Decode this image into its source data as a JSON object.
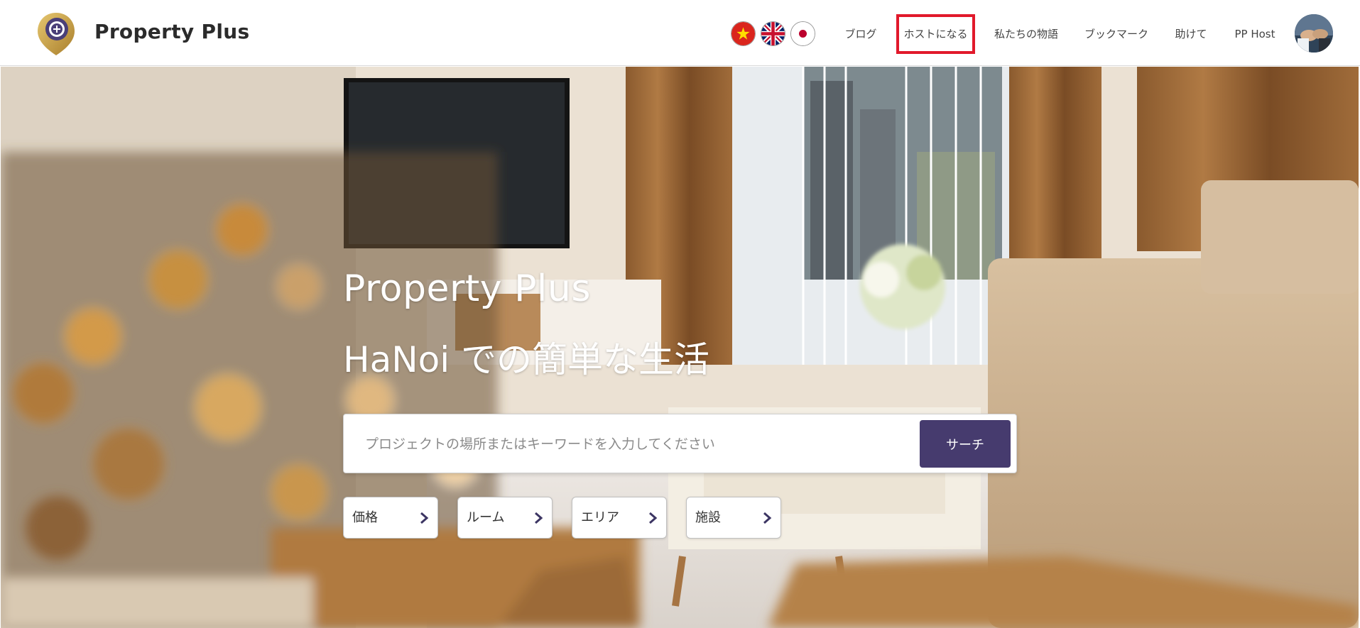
{
  "header": {
    "brand": "Property Plus",
    "flags": [
      {
        "name": "vietnam-flag-icon",
        "label": "Vietnamese"
      },
      {
        "name": "uk-flag-icon",
        "label": "English"
      },
      {
        "name": "japan-flag-icon",
        "label": "Japanese"
      }
    ],
    "nav": [
      {
        "id": "blog",
        "label": "ブログ"
      },
      {
        "id": "become-host",
        "label": "ホストになる",
        "highlighted": true
      },
      {
        "id": "our-story",
        "label": "私たちの物語"
      },
      {
        "id": "bookmark",
        "label": "ブックマーク"
      },
      {
        "id": "help",
        "label": "助けて"
      },
      {
        "id": "pp-host",
        "label": "PP Host"
      }
    ],
    "avatar_icon": "user-avatar"
  },
  "hero": {
    "title": "Property Plus",
    "subtitle": "HaNoi での簡単な生活",
    "search": {
      "placeholder": "プロジェクトの場所またはキーワードを入力してください",
      "value": "",
      "button_label": "サーチ"
    },
    "filters": [
      {
        "id": "price",
        "label": "価格"
      },
      {
        "id": "room",
        "label": "ルーム"
      },
      {
        "id": "area",
        "label": "エリア"
      },
      {
        "id": "facilities",
        "label": "施設"
      }
    ]
  },
  "colors": {
    "accent": "#463b6e",
    "highlight_border": "#e1192b",
    "logo_gold": "#c9a24a"
  }
}
